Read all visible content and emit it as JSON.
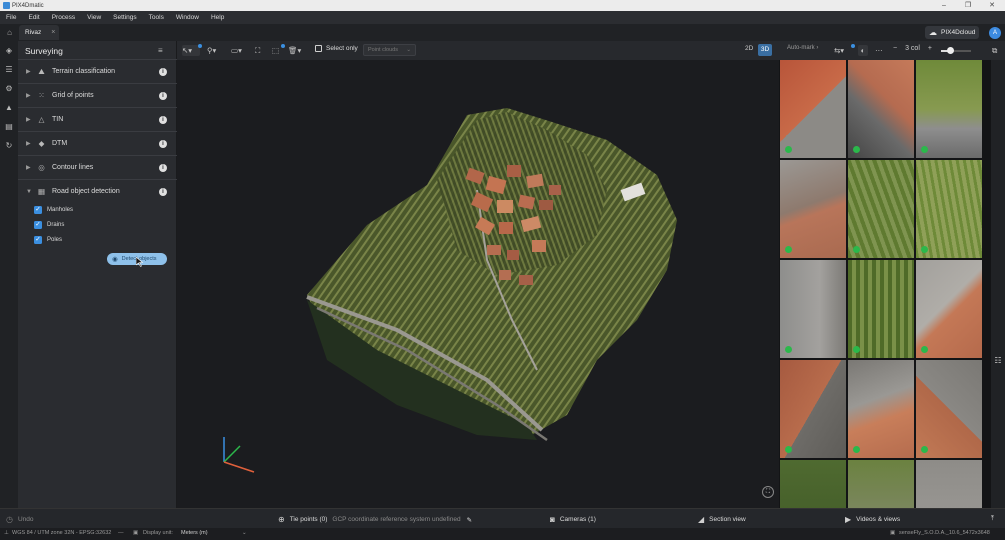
{
  "window": {
    "title": "PIX4Dmatic",
    "min": "–",
    "max": "❐",
    "close": "✕"
  },
  "menu": [
    "File",
    "Edit",
    "Process",
    "View",
    "Settings",
    "Tools",
    "Window",
    "Help"
  ],
  "tabs": {
    "home_icon": "home-icon",
    "project": "Rivaz",
    "close": "×"
  },
  "account": {
    "cloud_label": "PIX4Dcloud",
    "avatar": "A"
  },
  "panel": {
    "title": "Surveying",
    "sections": [
      {
        "label": "Terrain classification",
        "icon": "terrain-icon"
      },
      {
        "label": "Grid of points",
        "icon": "grid-icon"
      },
      {
        "label": "TIN",
        "icon": "tin-icon"
      },
      {
        "label": "DTM",
        "icon": "dtm-icon"
      },
      {
        "label": "Contour lines",
        "icon": "contour-icon"
      },
      {
        "label": "Road object detection",
        "icon": "road-icon",
        "expanded": true
      }
    ],
    "road_objects": [
      {
        "label": "Manholes",
        "checked": true
      },
      {
        "label": "Drains",
        "checked": true
      },
      {
        "label": "Poles",
        "checked": true
      }
    ],
    "detect_button": "Detect objects"
  },
  "toolbar": {
    "select_only": "Select only",
    "point_clouds_placeholder": "Point clouds",
    "view_2d": "2D",
    "view_3d": "3D",
    "automark": "Auto-mark",
    "minus": "−",
    "columns": "3 col",
    "plus": "+"
  },
  "bottom": {
    "undo": "Undo",
    "tie_points": "Tie points (0)",
    "gcp_status": "GCP coordinate reference system undefined",
    "cameras": "Cameras (1)",
    "section_view": "Section view",
    "videos_views": "Videos & views"
  },
  "status": {
    "crs": "WGS 84 / UTM zone 32N - EPSG:32632",
    "display_unit_label": "Display unit:",
    "display_unit_value": "Meters (m)",
    "camera": "senseFly_S.O.D.A._10.6_5472x3648"
  },
  "colors": {
    "accent": "#3b8fe0",
    "check": "#2bb84b",
    "panel": "#2a2c30",
    "viewport": "#1b1c1f"
  }
}
